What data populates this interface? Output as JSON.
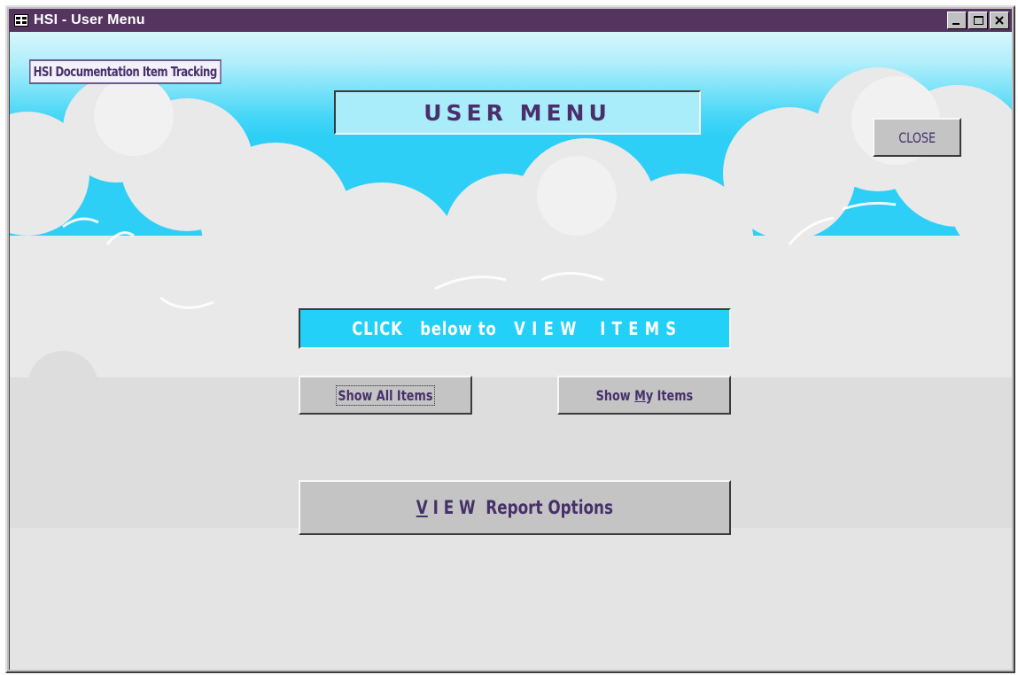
{
  "window": {
    "title": "HSI - User Menu",
    "app_icon": "form-icon"
  },
  "form": {
    "doc_label": "HSI Documentation Item Tracking",
    "header": "USER MENU",
    "close_label": "CLOSE",
    "click_banner": "CLICK   below to   V I E W    I T E M S",
    "show_all_label": "Show All Items",
    "show_my_pre": "Show ",
    "show_my_key": "M",
    "show_my_post": "y Items",
    "view_report_key": "V",
    "view_report_post": " I E W  Report Options"
  },
  "colors": {
    "titlebar": "#55345f",
    "header_bg": "#a9ecfa",
    "banner_bg": "#23d0f8",
    "text_purple": "#46306a"
  }
}
